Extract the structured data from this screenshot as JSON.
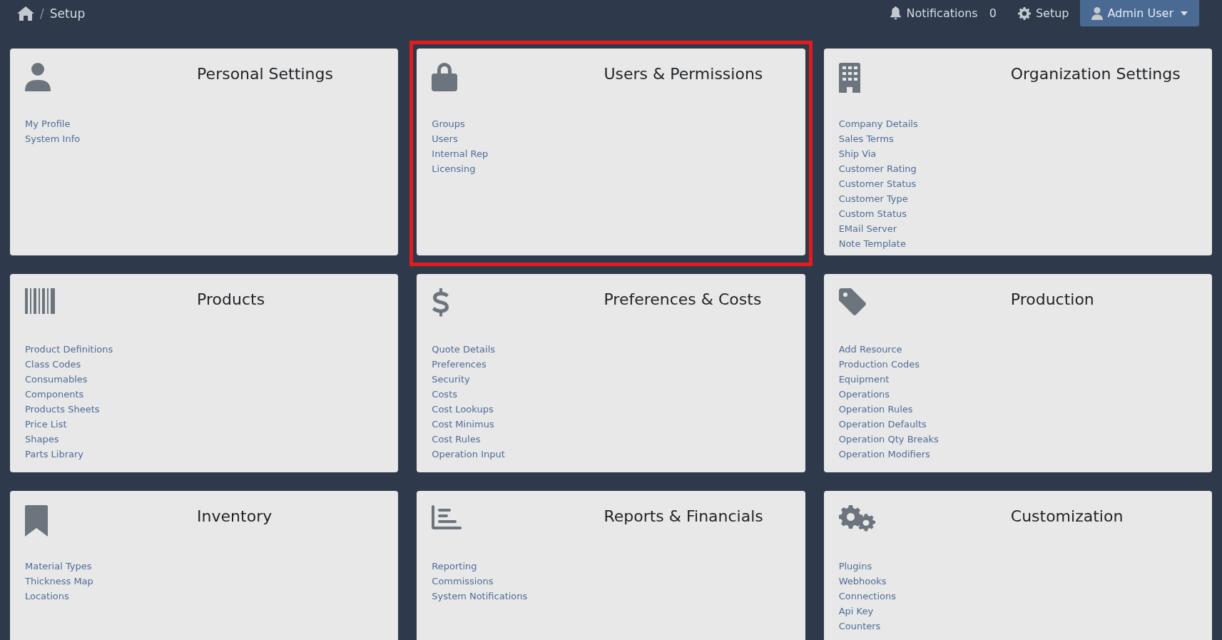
{
  "breadcrumb": {
    "separator": "/",
    "current": "Setup"
  },
  "navbar": {
    "notifications_label": "Notifications",
    "notifications_count": "0",
    "setup_label": "Setup",
    "user_label": "Admin User"
  },
  "cards": [
    {
      "title": "Personal Settings",
      "highlighted": false,
      "links": [
        "My Profile",
        "System Info"
      ]
    },
    {
      "title": "Users & Permissions",
      "highlighted": true,
      "links": [
        "Groups",
        "Users",
        "Internal Rep",
        "Licensing"
      ]
    },
    {
      "title": "Organization Settings",
      "highlighted": false,
      "links": [
        "Company Details",
        "Sales Terms",
        "Ship Via",
        "Customer Rating",
        "Customer Status",
        "Customer Type",
        "Custom Status",
        "EMail Server",
        "Note Template"
      ]
    },
    {
      "title": "Products",
      "highlighted": false,
      "links": [
        "Product Definitions",
        "Class Codes",
        "Consumables",
        "Components",
        "Products Sheets",
        "Price List",
        "Shapes",
        "Parts Library"
      ]
    },
    {
      "title": "Preferences & Costs",
      "highlighted": false,
      "links": [
        "Quote Details",
        "Preferences",
        "Security",
        "Costs",
        "Cost Lookups",
        "Cost Minimus",
        "Cost Rules",
        "Operation Input"
      ]
    },
    {
      "title": "Production",
      "highlighted": false,
      "links": [
        "Add Resource",
        "Production Codes",
        "Equipment",
        "Operations",
        "Operation Rules",
        "Operation Defaults",
        "Operation Qty Breaks",
        "Operation Modifiers"
      ]
    },
    {
      "title": "Inventory",
      "highlighted": false,
      "links": [
        "Material Types",
        "Thickness Map",
        "Locations"
      ]
    },
    {
      "title": "Reports & Financials",
      "highlighted": false,
      "links": [
        "Reporting",
        "Commissions",
        "System Notifications"
      ]
    },
    {
      "title": "Customization",
      "highlighted": false,
      "links": [
        "Plugins",
        "Webhooks",
        "Connections",
        "Api Key",
        "Counters"
      ]
    }
  ]
}
